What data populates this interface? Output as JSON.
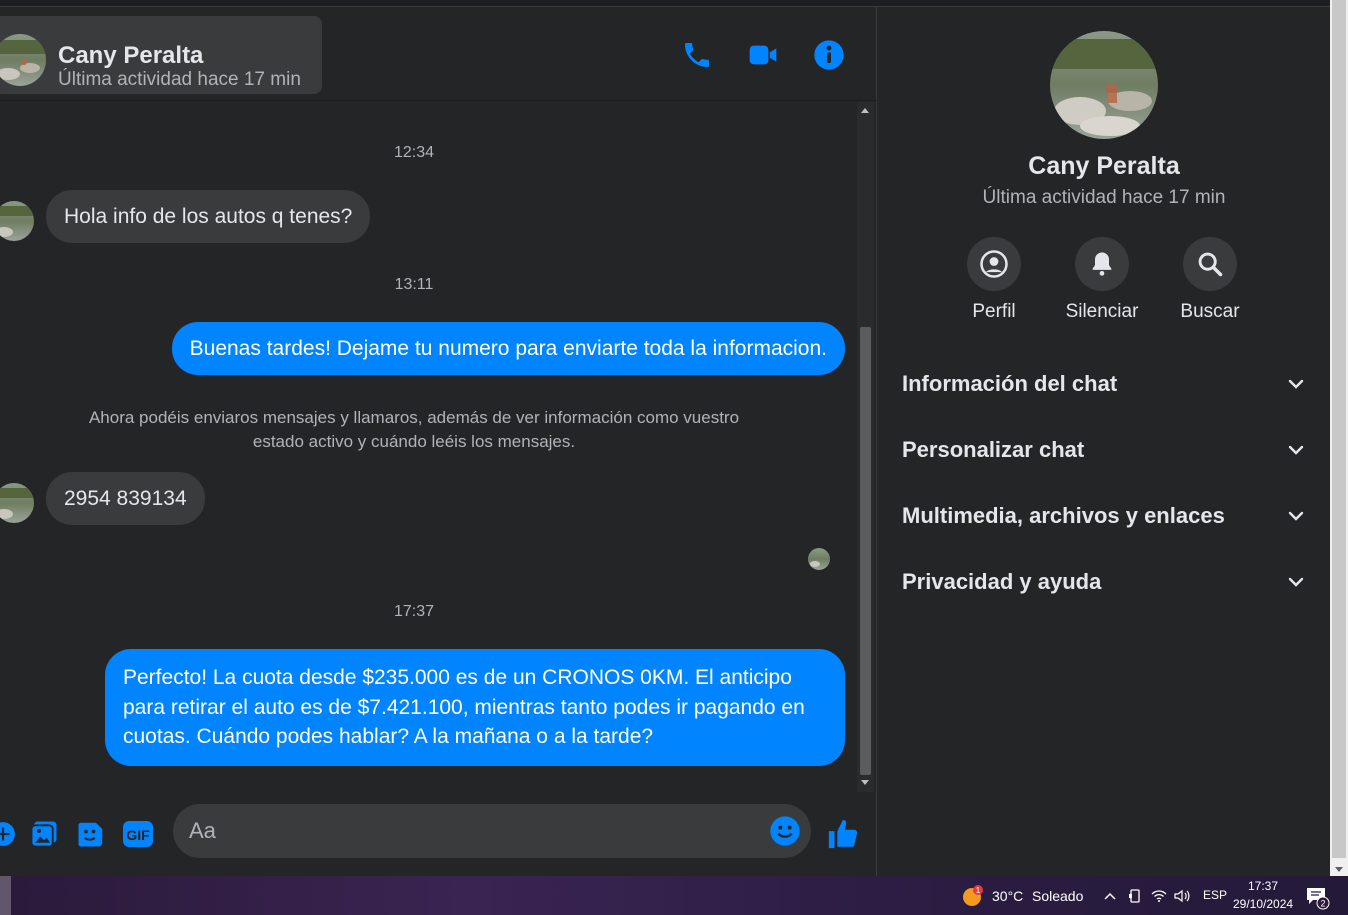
{
  "contact": {
    "name": "Cany Peralta",
    "status": "Última actividad hace 17 min"
  },
  "header": {
    "call_icon": "phone-icon",
    "video_icon": "video-camera-icon",
    "info_icon": "info-icon"
  },
  "messages": [
    {
      "type": "timestamp",
      "text": "12:34"
    },
    {
      "type": "incoming",
      "text": "Hola info de los autos q tenes?"
    },
    {
      "type": "timestamp",
      "text": "13:11"
    },
    {
      "type": "outgoing",
      "text": "Buenas tardes! Dejame tu numero para enviarte toda la informacion."
    },
    {
      "type": "system",
      "text": "Ahora podéis enviaros mensajes y llamaros, además de ver información como vuestro estado activo y cuándo leéis los mensajes."
    },
    {
      "type": "incoming",
      "text": "2954 839134"
    },
    {
      "type": "timestamp",
      "text": "17:37"
    },
    {
      "type": "outgoing",
      "text": "Perfecto! La cuota desde $235.000 es de un CRONOS 0KM. El anticipo para retirar el auto es de $7.421.100, mientras tanto podes ir pagando en cuotas. Cuándo podes hablar? A la mañana o a la tarde?"
    }
  ],
  "composer": {
    "placeholder": "Aa",
    "icons": [
      "plus-icon",
      "image-icon",
      "sticker-icon",
      "gif-icon",
      "emoji-icon",
      "thumbs-up-icon"
    ],
    "gif_label": "GIF"
  },
  "panel": {
    "actions": [
      {
        "label": "Perfil",
        "icon": "profile-icon"
      },
      {
        "label": "Silenciar",
        "icon": "bell-icon"
      },
      {
        "label": "Buscar",
        "icon": "search-icon"
      }
    ],
    "sections": [
      {
        "label": "Información del chat"
      },
      {
        "label": "Personalizar chat"
      },
      {
        "label": "Multimedia, archivos y enlaces"
      },
      {
        "label": "Privacidad y ayuda"
      }
    ]
  },
  "taskbar": {
    "weather_temp": "30°C",
    "weather_desc": "Soleado",
    "weather_badge": "1",
    "language": "ESP",
    "time": "17:37",
    "date": "29/10/2024",
    "notification_count": "2"
  },
  "colors": {
    "accent": "#0084ff",
    "background": "#242526",
    "bubble_in": "#3a3b3c",
    "text_secondary": "#b0b3b8"
  }
}
